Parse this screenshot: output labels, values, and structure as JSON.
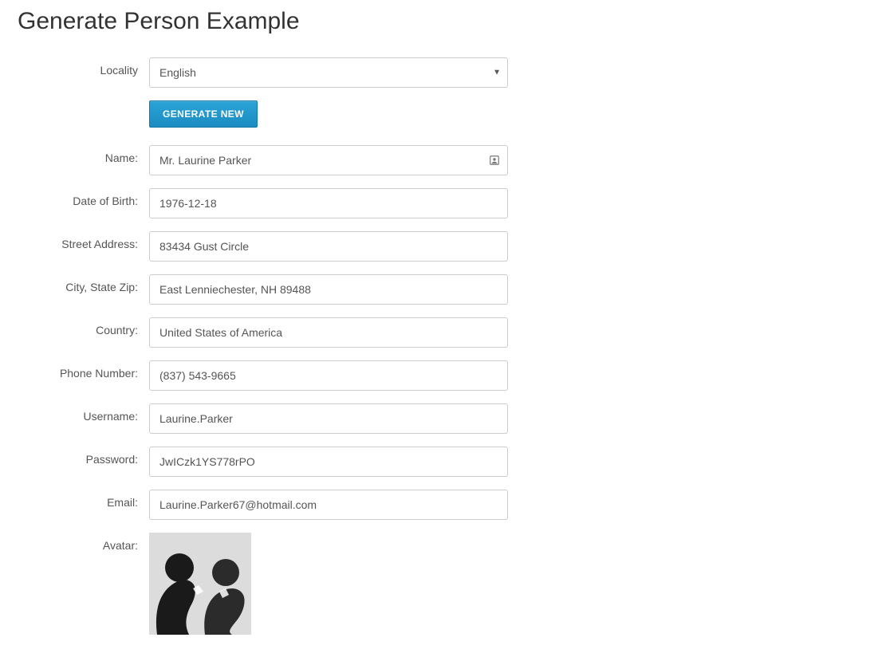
{
  "page": {
    "title": "Generate Person Example"
  },
  "locality": {
    "label": "Locality",
    "selected": "English"
  },
  "button": {
    "generate": "GENERATE NEW"
  },
  "fields": {
    "name": {
      "label": "Name:",
      "value": "Mr. Laurine Parker"
    },
    "dob": {
      "label": "Date of Birth:",
      "value": "1976-12-18"
    },
    "street": {
      "label": "Street Address:",
      "value": "83434 Gust Circle"
    },
    "csz": {
      "label": "City, State Zip:",
      "value": "East Lenniechester, NH 89488"
    },
    "country": {
      "label": "Country:",
      "value": "United States of America"
    },
    "phone": {
      "label": "Phone Number:",
      "value": "(837) 543-9665"
    },
    "username": {
      "label": "Username:",
      "value": "Laurine.Parker"
    },
    "password": {
      "label": "Password:",
      "value": "JwICzk1YS778rPO"
    },
    "email": {
      "label": "Email:",
      "value": "Laurine.Parker67@hotmail.com"
    },
    "avatar": {
      "label": "Avatar:"
    }
  }
}
